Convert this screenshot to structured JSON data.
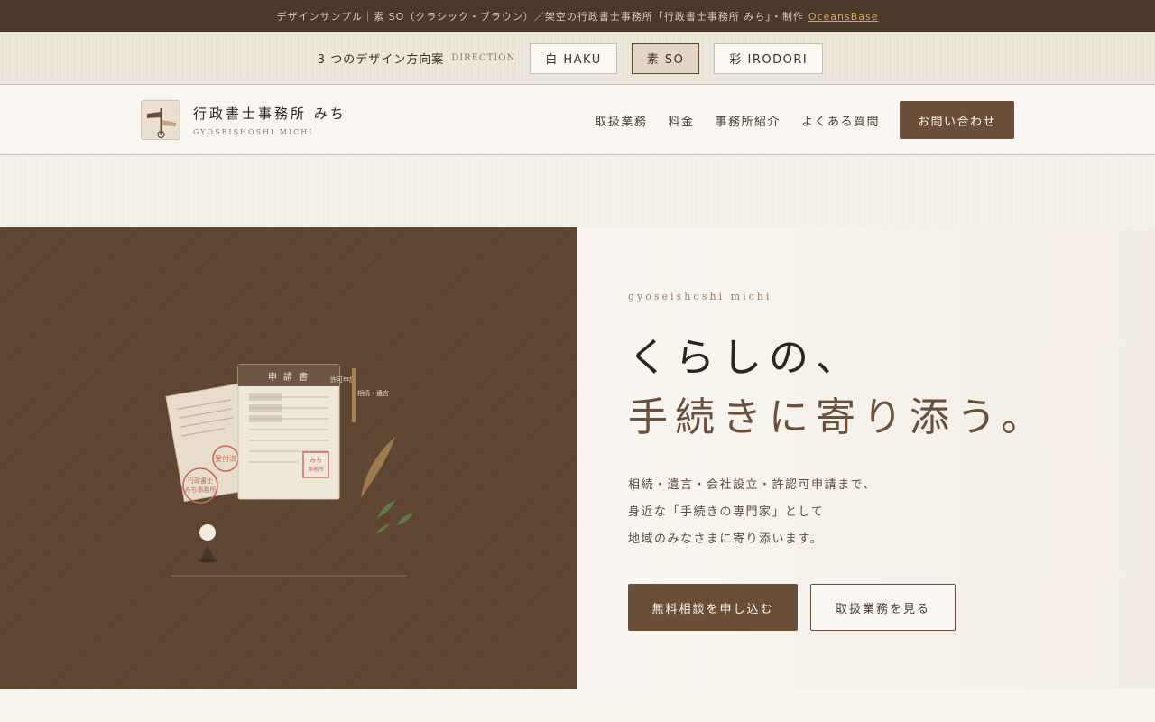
{
  "banner": {
    "text": "デザインサンプル｜素 SO（クラシック・ブラウン）／架空の行政書士事務所「行政書士事務所 みち」・制作",
    "link": "OceansBase"
  },
  "switcher": {
    "label": "3 つのデザイン方向案",
    "sub": "DIRECTION",
    "options": [
      {
        "label": "白 HAKU",
        "active": false
      },
      {
        "label": "素 SO",
        "active": true
      },
      {
        "label": "彩 IRODORI",
        "active": false
      }
    ]
  },
  "header": {
    "name": "行政書士事務所 みち",
    "roman": "GYOSEISHOSHI MICHI",
    "nav": [
      "取扱業務",
      "料金",
      "事務所紹介",
      "よくある質問"
    ],
    "cta": "お問い合わせ"
  },
  "hero": {
    "eyebrow": "gyoseishoshi michi",
    "headline_1": "くらしの、",
    "headline_2": "手続きに寄り添う。",
    "lead": [
      "相続・遺言・会社設立・許認可申請まで、",
      "身近な「手続きの専門家」として",
      "地域のみなさまに寄り添います。"
    ],
    "primary_cta": "無料相談を申し込む",
    "secondary_cta": "取扱業務を見る",
    "illustration": {
      "doc_title": "申 請 書",
      "tag_1": "許可申請",
      "tag_2": "相続・遺言",
      "stamp_1": "受付済",
      "stamp_2a": "行政書士",
      "stamp_2b": "みち事務所",
      "seal_1": "みち",
      "seal_2": "事務所"
    }
  },
  "colors": {
    "brand_brown": "#6a4e38",
    "banner_bg": "#4b3a2c",
    "hero_panel": "#5f4633",
    "link_gold": "#d3a863"
  }
}
